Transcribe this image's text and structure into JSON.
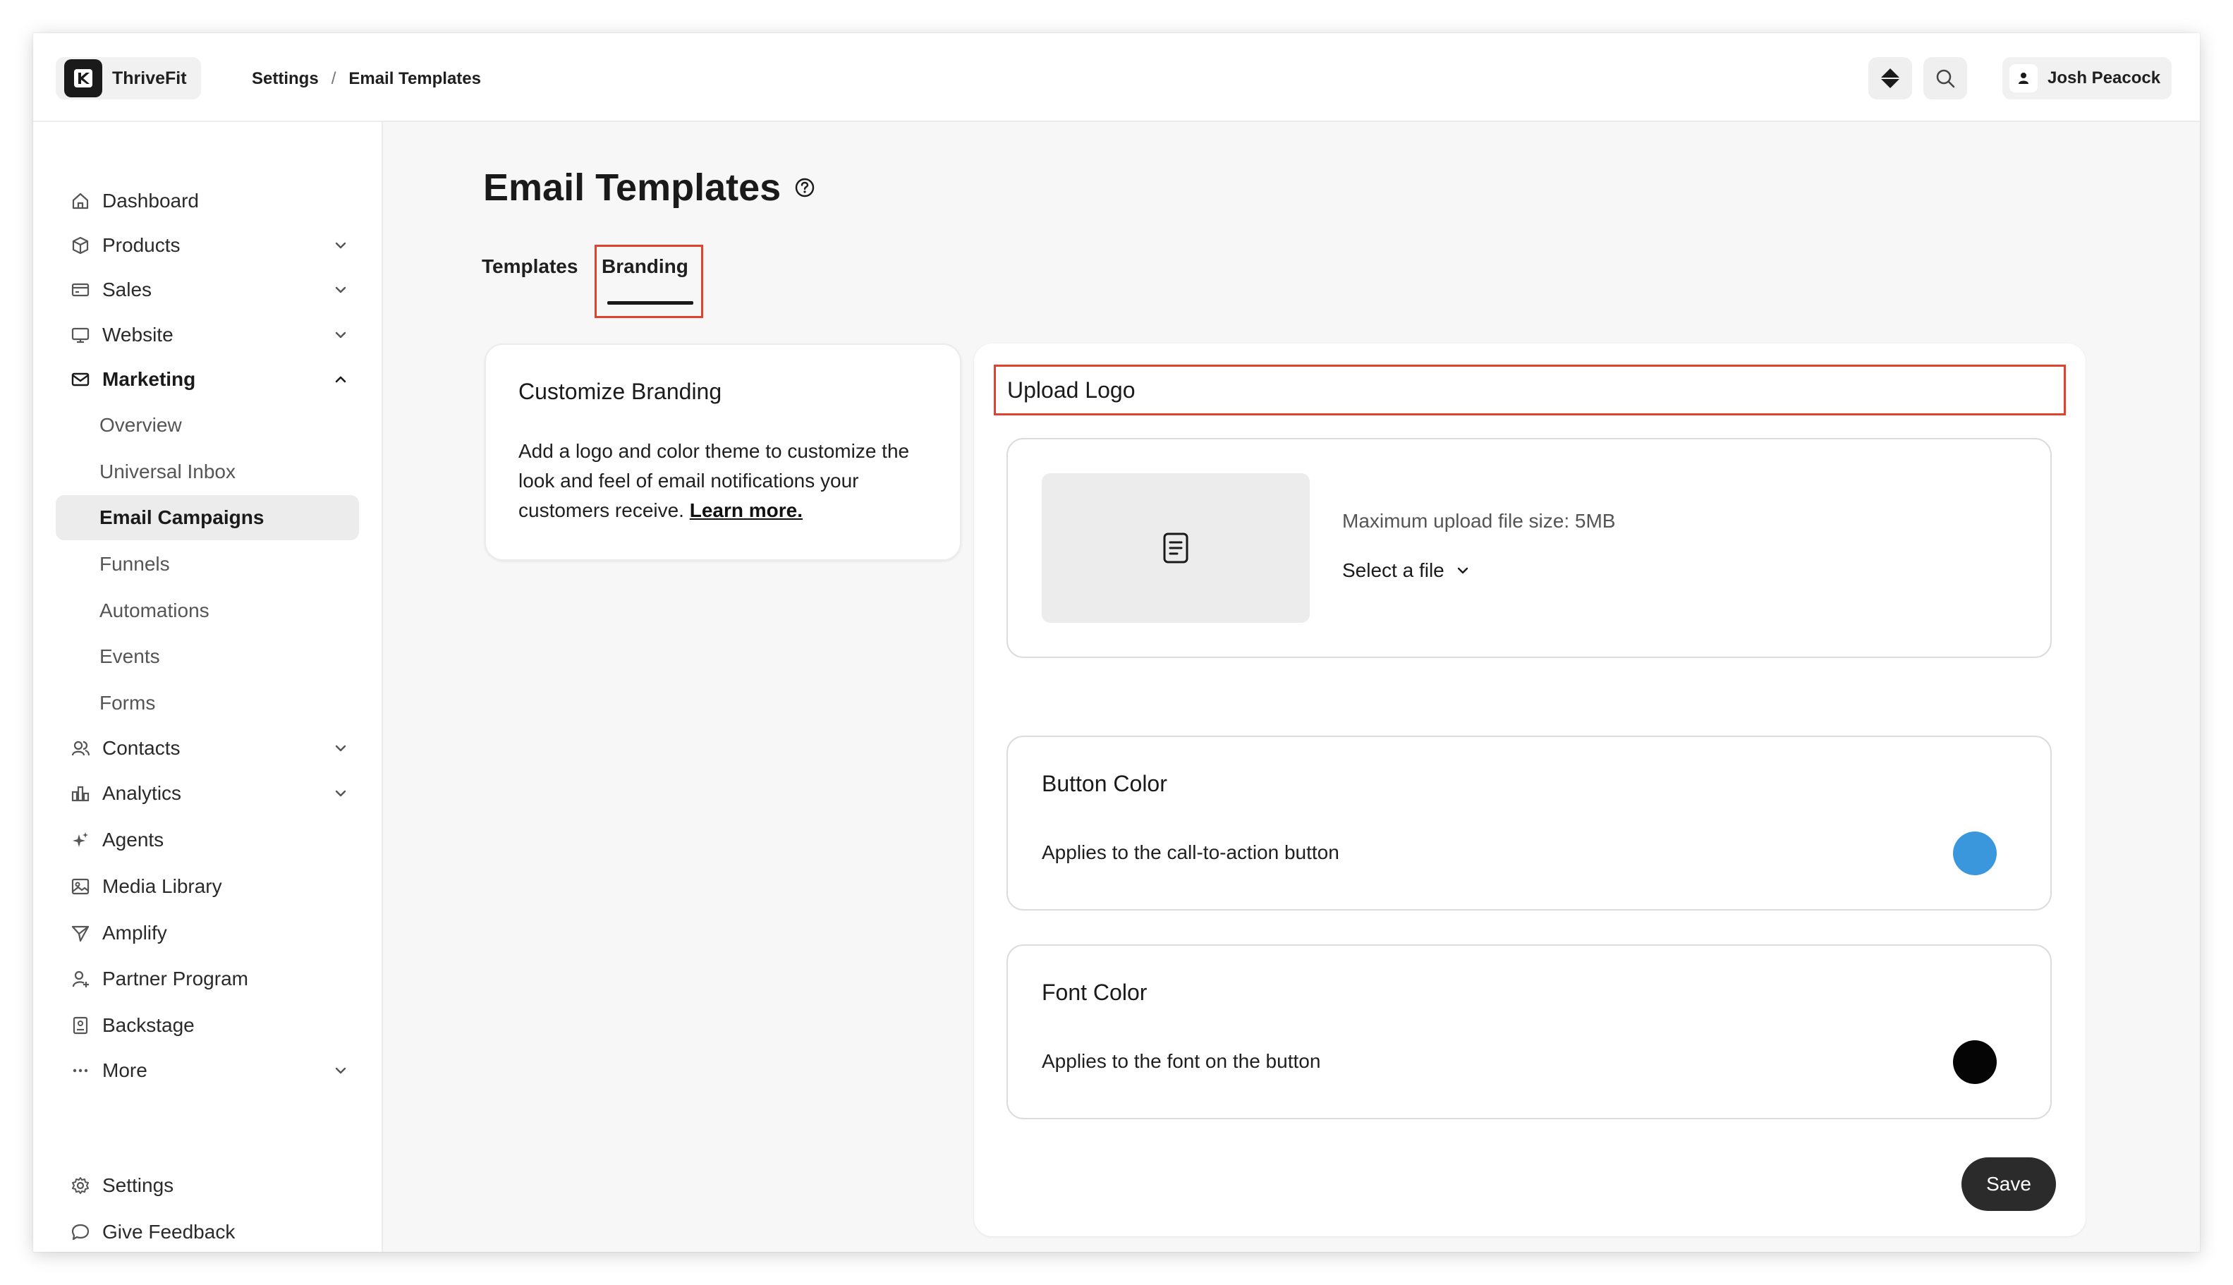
{
  "app": {
    "name": "ThriveFit"
  },
  "breadcrumb": {
    "parent": "Settings",
    "separator": "/",
    "current": "Email Templates"
  },
  "user": {
    "name": "Josh Peacock"
  },
  "sidebar": {
    "items": [
      {
        "label": "Dashboard",
        "icon": "home-icon"
      },
      {
        "label": "Products",
        "icon": "box-icon",
        "expandable": true
      },
      {
        "label": "Sales",
        "icon": "credit-card-icon",
        "expandable": true
      },
      {
        "label": "Website",
        "icon": "monitor-icon",
        "expandable": true
      },
      {
        "label": "Marketing",
        "icon": "mail-icon",
        "expanded": true
      }
    ],
    "marketing_sub": [
      "Overview",
      "Universal Inbox",
      "Email Campaigns",
      "Funnels",
      "Automations",
      "Events",
      "Forms"
    ],
    "active_sub": "Email Campaigns",
    "items2": [
      {
        "label": "Contacts",
        "icon": "users-icon",
        "expandable": true
      },
      {
        "label": "Analytics",
        "icon": "bar-chart-icon",
        "expandable": true
      },
      {
        "label": "Agents",
        "icon": "sparkle-icon"
      },
      {
        "label": "Media Library",
        "icon": "image-icon"
      },
      {
        "label": "Amplify",
        "icon": "send-icon"
      },
      {
        "label": "Partner Program",
        "icon": "partner-icon"
      },
      {
        "label": "Backstage",
        "icon": "badge-icon"
      },
      {
        "label": "More",
        "icon": "more-dots-icon",
        "expandable": true
      }
    ],
    "footer": [
      {
        "label": "Settings",
        "icon": "gear-icon"
      },
      {
        "label": "Give Feedback",
        "icon": "chat-icon"
      }
    ]
  },
  "page": {
    "title": "Email Templates"
  },
  "tabs": [
    {
      "label": "Templates",
      "active": false
    },
    {
      "label": "Branding",
      "active": true
    }
  ],
  "branding_info": {
    "title": "Customize Branding",
    "body": "Add a logo and color theme to customize the look and feel of email notifications your customers receive.",
    "link": "Learn more."
  },
  "upload": {
    "title": "Upload Logo",
    "max_size": "Maximum upload file size: 5MB",
    "select_label": "Select a file"
  },
  "button_color": {
    "title": "Button Color",
    "desc": "Applies to the call-to-action button",
    "color": "#3a97dc"
  },
  "font_color": {
    "title": "Font Color",
    "desc": "Applies to the font on the button",
    "color": "#050505"
  },
  "actions": {
    "save": "Save"
  },
  "colors": {
    "highlight": "#e0432d",
    "dark": "#2b2b2b"
  }
}
